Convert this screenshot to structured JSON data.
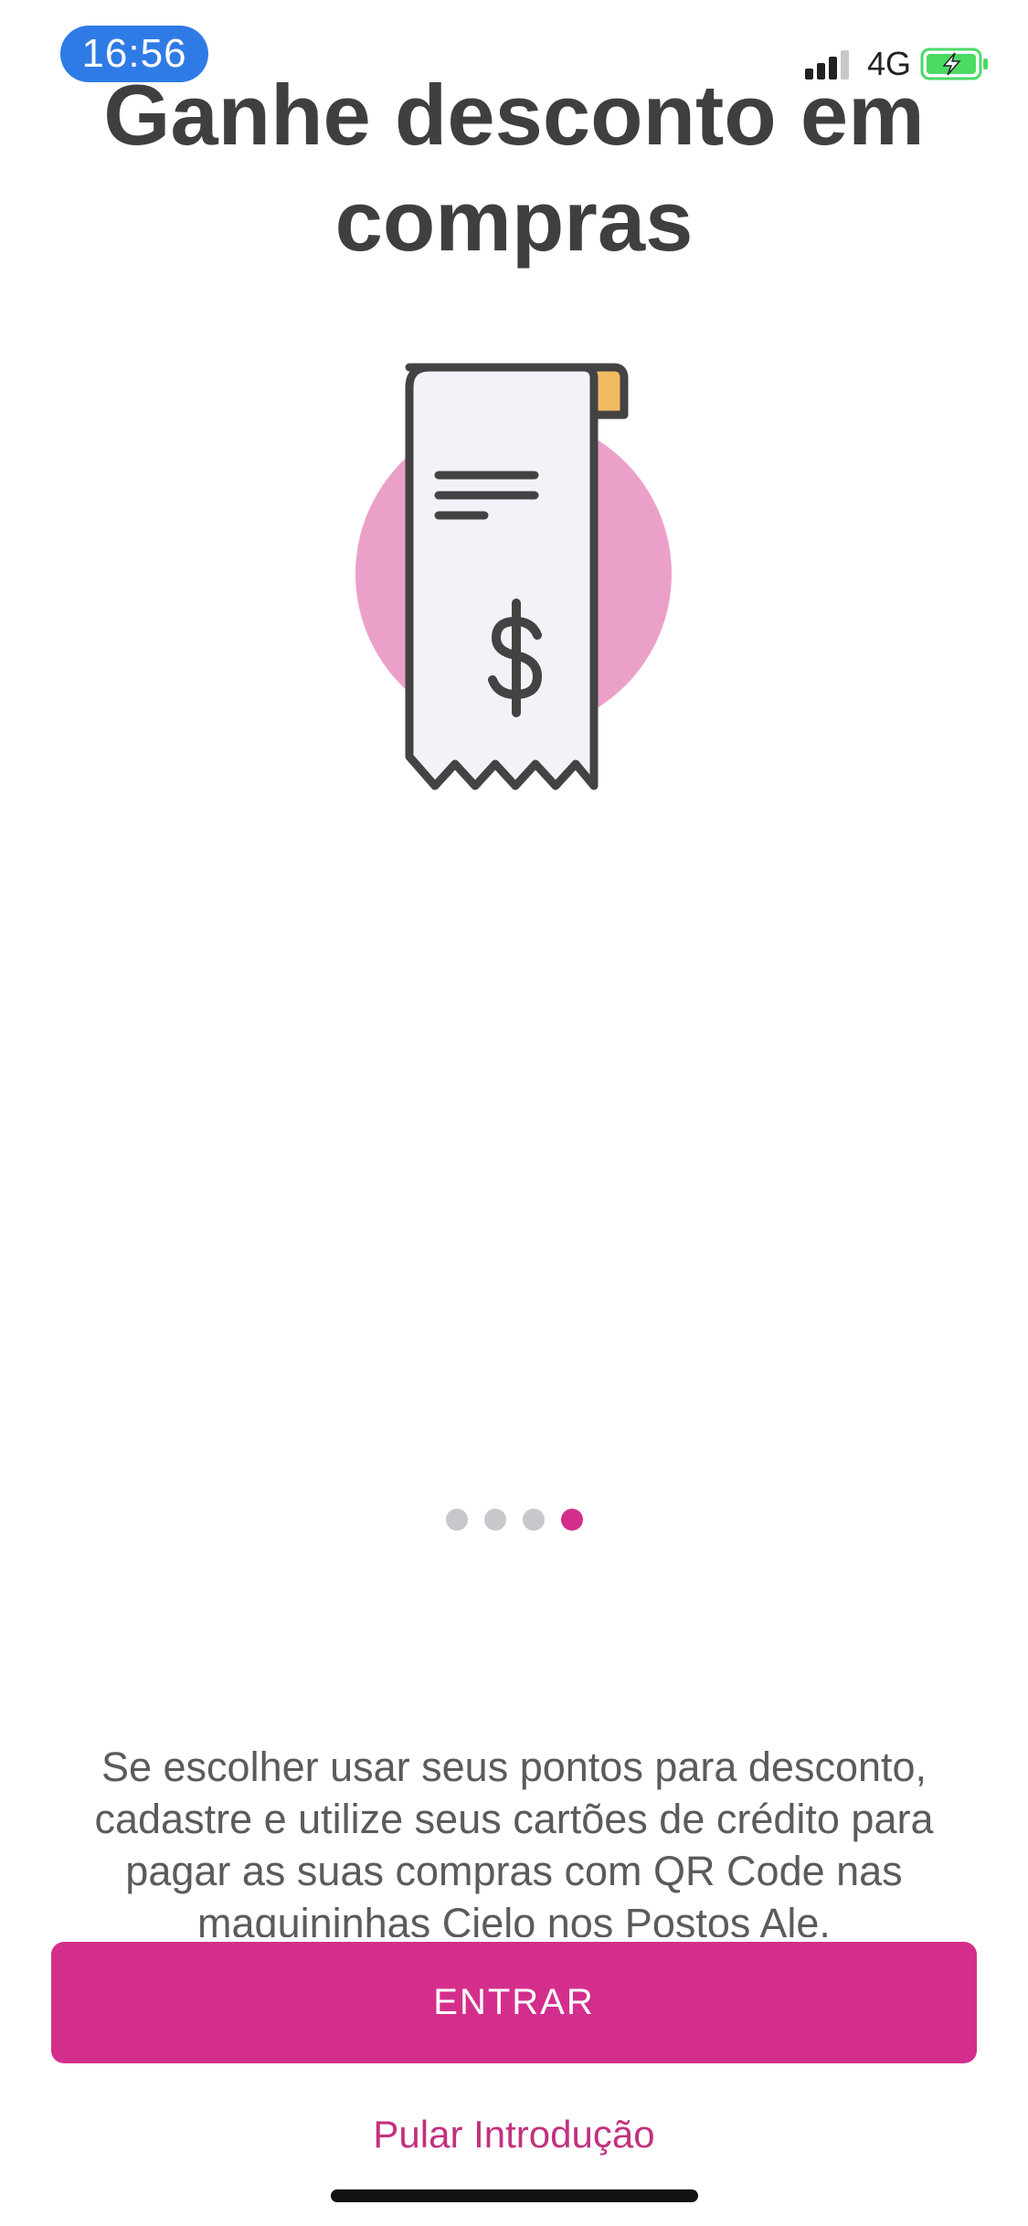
{
  "status_bar": {
    "time": "16:56",
    "network": "4G",
    "signal_icon": "cellular-signal-icon",
    "battery_icon": "battery-charging-icon",
    "time_pill_color": "#2f7be6",
    "battery_color": "#4cd964"
  },
  "onboarding": {
    "title": "Ganhe desconto em compras",
    "illustration": {
      "icon": "receipt-dollar-icon",
      "circle_color": "#eba0ca",
      "tab_color": "#f2bb62",
      "paper_color": "#f3f2f8",
      "stroke_color": "#434343"
    },
    "pager": {
      "total": 4,
      "active_index": 3,
      "active_color": "#d42e8c",
      "inactive_color": "#c8c8cc"
    },
    "description": "Se escolher usar seus pontos para desconto, cadastre e utilize seus cartões de crédito para pagar as suas compras com QR Code nas maquininhas Cielo nos Postos Ale."
  },
  "actions": {
    "primary_label": "ENTRAR",
    "primary_color": "#d42e8c",
    "skip_label": "Pular Introdução",
    "skip_color": "#c2317f"
  }
}
